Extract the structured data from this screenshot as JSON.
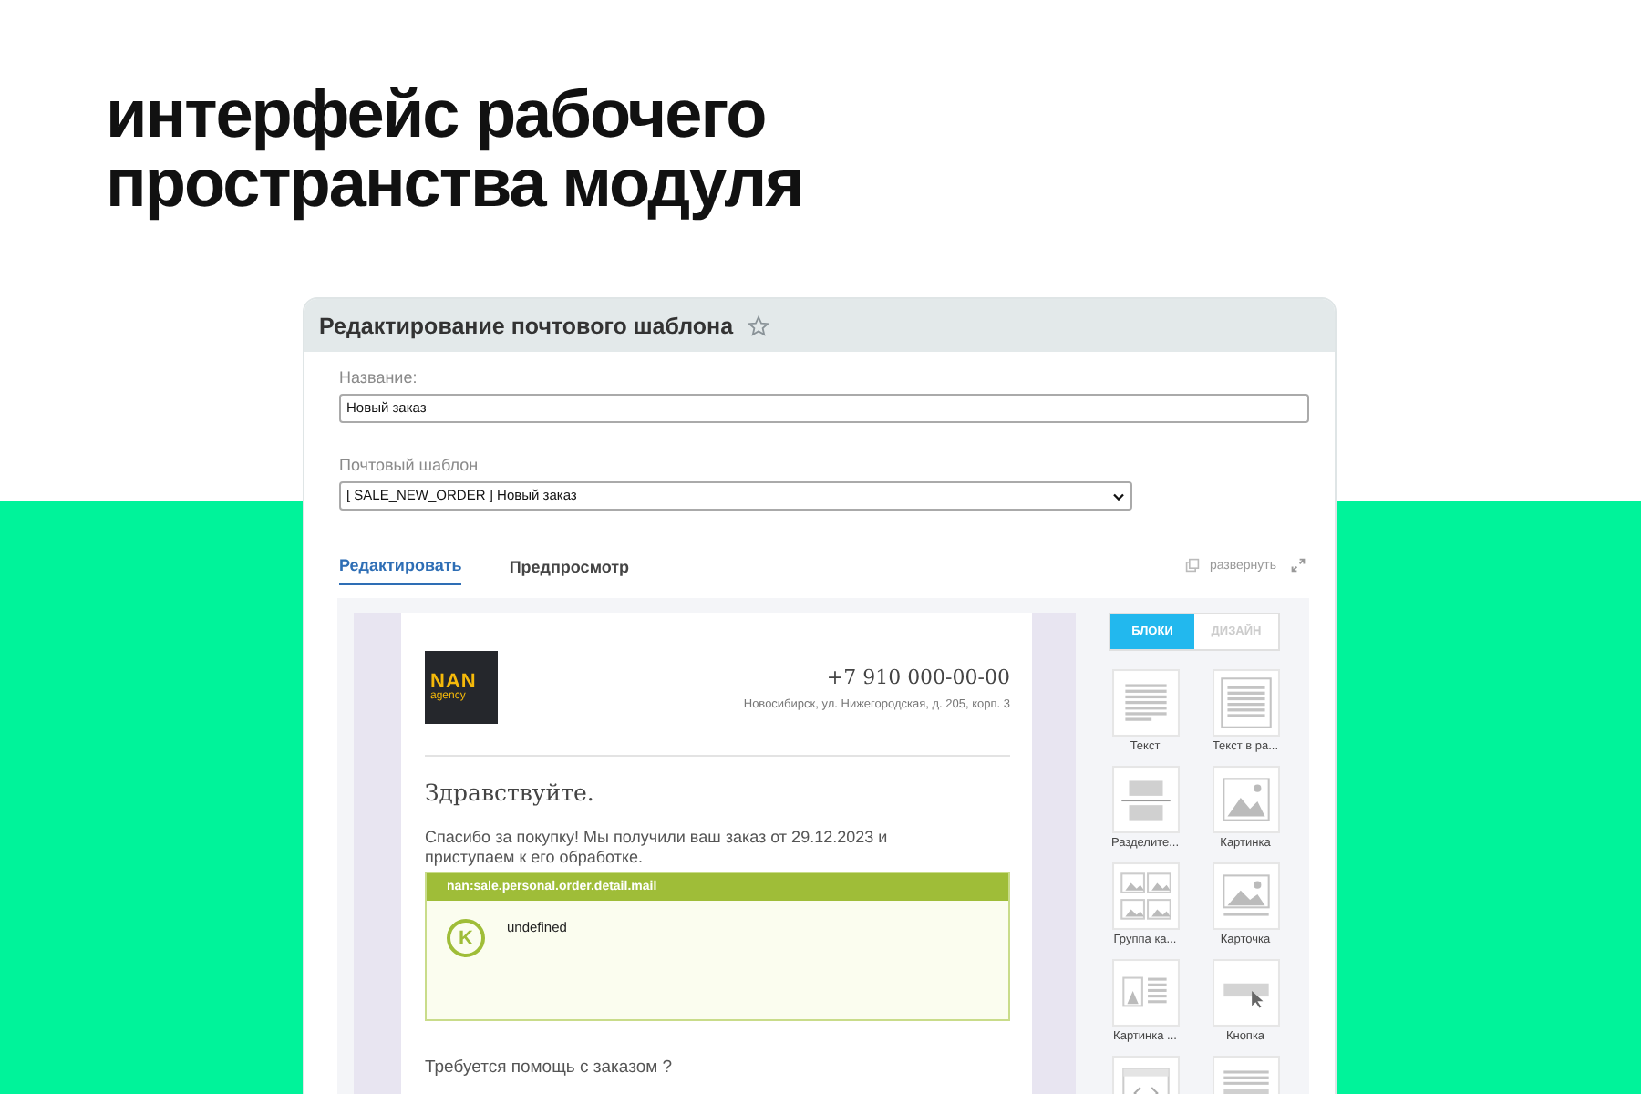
{
  "headline": "интерфейс рабочего пространства модуля",
  "window": {
    "title": "Редактирование почтового шаблона",
    "favorite": false
  },
  "fields": [
    {
      "label": "Название:",
      "value": "Новый заказ",
      "kind": "text"
    },
    {
      "label": "Почтовый шаблон",
      "value": "[ SALE_NEW_ORDER ] Новый заказ",
      "kind": "select"
    }
  ],
  "tabs": [
    {
      "label": "Редактировать",
      "selected": true
    },
    {
      "label": "Предпросмотр",
      "selected": false
    }
  ],
  "expand_link": "развернуть",
  "email": {
    "logo": {
      "top": "NAN",
      "bottom": "agency"
    },
    "phone": "+7 910 000-00-00",
    "address": "Новосибирск, ул. Нижегородская, д. 205, корп. 3",
    "greeting": "Здравствуйте.",
    "body": "Спасибо за покупку! Мы получили ваш заказ от 29.12.2023 и приступаем к его обработке.",
    "component": {
      "name": "nan:sale.personal.order.detail.mail",
      "badge": "K",
      "text": "undefined"
    },
    "help": "Требуется помощь с заказом ?"
  },
  "palette_tabs": [
    {
      "label": "БЛОКИ",
      "selected": true
    },
    {
      "label": "ДИЗАЙН",
      "selected": false
    }
  ],
  "blocks": [
    {
      "label": "Текст",
      "kind": "text"
    },
    {
      "label": "Текст в ра...",
      "kind": "framed-text"
    },
    {
      "label": "Разделите...",
      "kind": "divider"
    },
    {
      "label": "Картинка",
      "kind": "image"
    },
    {
      "label": "Группа ка...",
      "kind": "gallery"
    },
    {
      "label": "Карточка",
      "kind": "card"
    },
    {
      "label": "Картинка ...",
      "kind": "image-text"
    },
    {
      "label": "Кнопка",
      "kind": "button"
    },
    {
      "kind": "code"
    },
    {
      "kind": "text-bar"
    }
  ]
}
